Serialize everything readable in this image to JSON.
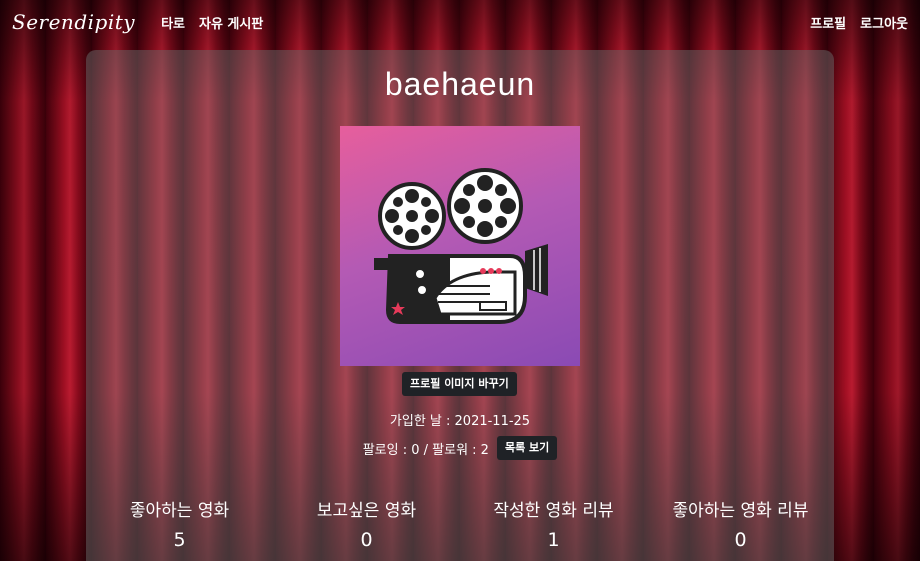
{
  "nav": {
    "brand": "Serendipity",
    "links": [
      "타로",
      "자유 게시판"
    ],
    "right_links": [
      "프로필",
      "로그아웃"
    ]
  },
  "profile": {
    "username": "baehaeun",
    "image_alt": "film projector illustration",
    "change_image_button": "프로필 이미지 바꾸기",
    "join_date": "가입한 날 : 2021-11-25",
    "follow_text": "팔로잉 : 0 / 팔로워 : 2",
    "list_button": "목록 보기"
  },
  "stats": [
    {
      "label": "좋아하는 영화",
      "value": "5"
    },
    {
      "label": "보고싶은 영화",
      "value": "0"
    },
    {
      "label": "작성한 영화 리뷰",
      "value": "1"
    },
    {
      "label": "좋아하는 영화 리뷰",
      "value": "0"
    }
  ],
  "colors": {
    "card_bg": "#696969",
    "button_dark": "#1f2226",
    "curtain_red": "#c3132b",
    "image_pink": "#e75e9c",
    "image_purple": "#8a4ab4"
  }
}
